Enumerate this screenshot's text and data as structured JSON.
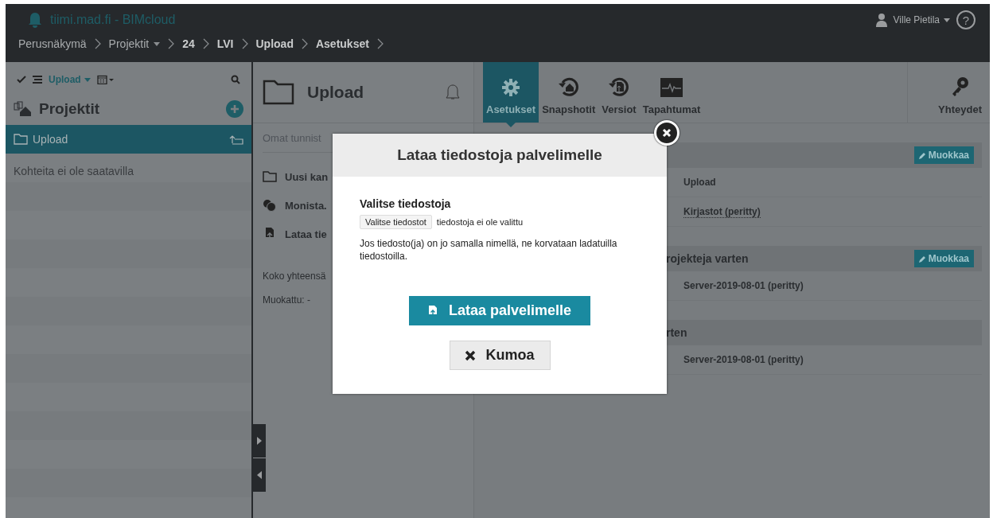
{
  "header": {
    "title": "tiimi.mad.fi - BIMcloud",
    "user": "Ville Pietila",
    "help": "?",
    "breadcrumb": [
      {
        "label": "Perusnäkymä",
        "bold": false,
        "dropdown": false
      },
      {
        "label": "Projektit",
        "bold": false,
        "dropdown": true
      },
      {
        "label": "24",
        "bold": true,
        "dropdown": false
      },
      {
        "label": "LVI",
        "bold": true,
        "dropdown": false
      },
      {
        "label": "Upload",
        "bold": true,
        "dropdown": false
      },
      {
        "label": "Asetukset",
        "bold": true,
        "dropdown": false
      }
    ]
  },
  "sidebar": {
    "filter": "Upload",
    "title": "Projektit",
    "items": [
      {
        "label": "Upload",
        "selected": true
      }
    ],
    "empty_text": "Kohteita ei ole saatavilla"
  },
  "middle": {
    "title": "Upload",
    "search": {
      "placeholder": "Omat tunnist"
    },
    "actions": [
      {
        "label": "Uusi kan",
        "kind": "folder"
      },
      {
        "label": "Monista.",
        "kind": "duplicate"
      },
      {
        "label": "Lataa tie",
        "kind": "upload"
      }
    ],
    "info": [
      "Koko yhteensä",
      "Muokattu: -"
    ]
  },
  "tabs": [
    {
      "label": "Asetukset",
      "kind": "settings",
      "selected": true
    },
    {
      "label": "Snapshotit",
      "kind": "snapshots",
      "selected": false
    },
    {
      "label": "Versiot",
      "kind": "versions",
      "selected": false
    },
    {
      "label": "Tapahtumat",
      "kind": "events",
      "selected": false
    }
  ],
  "connections_tab": "Yhteydet",
  "sections": [
    {
      "edit": "Muokkaa",
      "rows": [
        {
          "value": "Upload",
          "link": false
        },
        {
          "value": "Kirjastot (peritty)",
          "link": true
        }
      ]
    },
    {
      "title": "rojekteja varten",
      "edit": "Muokkaa",
      "rows": [
        {
          "value": "Server-2019-08-01 (peritty)",
          "link": false
        }
      ]
    },
    {
      "title": "rten",
      "rows": [
        {
          "value": "Server-2019-08-01 (peritty)",
          "link": false
        }
      ]
    }
  ],
  "dialog": {
    "title": "Lataa tiedostoja palvelimelle",
    "field_label": "Valitse tiedostoja",
    "file_button": "Valitse tiedostot",
    "file_status": "tiedostoja ei ole valittu",
    "note": "Jos tiedosto(ja) on jo samalla nimellä, ne korvataan ladatuilla tiedostoilla.",
    "primary": "Lataa palvelimelle",
    "cancel": "Kumoa"
  }
}
